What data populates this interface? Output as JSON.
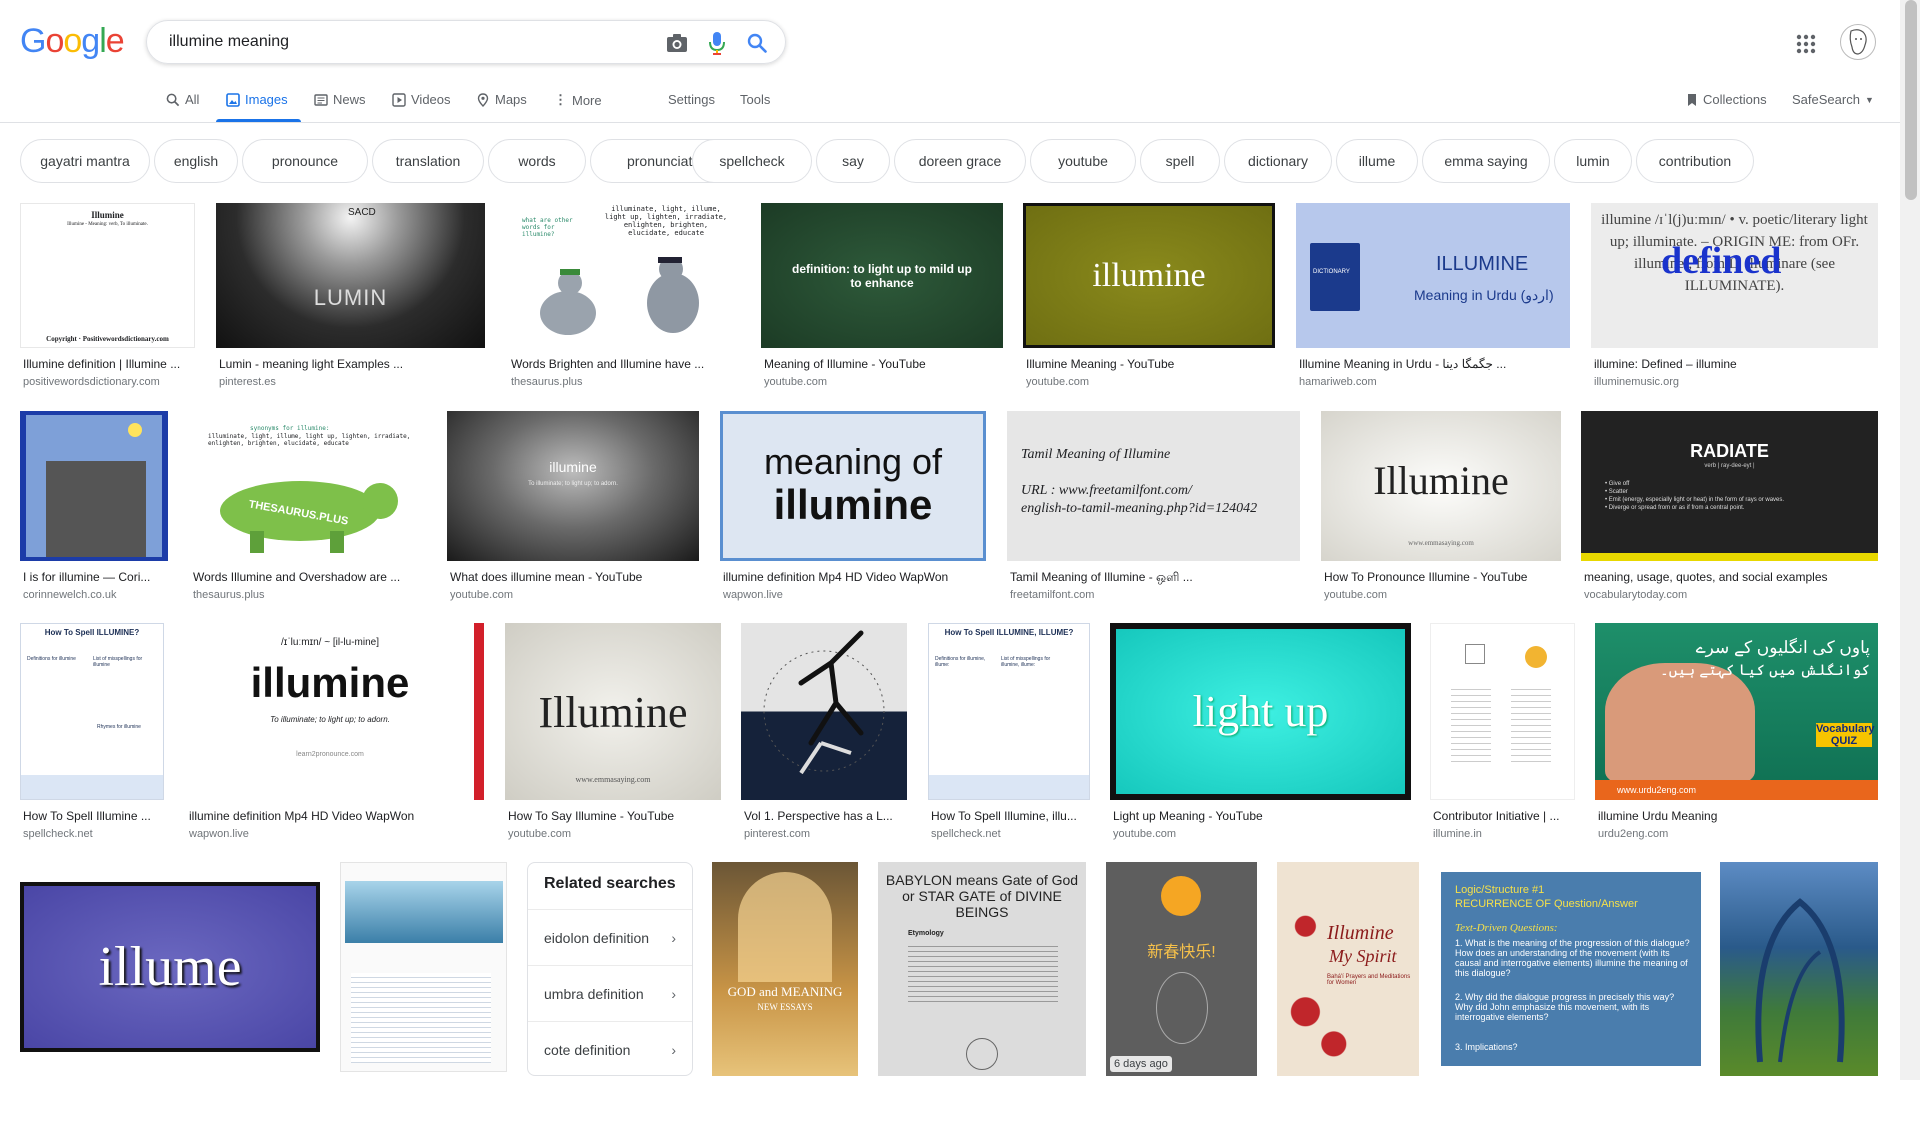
{
  "header": {
    "logo_letters": [
      "G",
      "o",
      "o",
      "g",
      "l",
      "e"
    ],
    "logo_colors": [
      "#4285f4",
      "#ea4335",
      "#fbbc05",
      "#4285f4",
      "#34a853",
      "#ea4335"
    ],
    "search_value": "illumine meaning",
    "camera_icon": "camera-icon",
    "mic_icon": "mic-icon",
    "search_icon": "search-icon",
    "apps_icon": "apps-grid-icon"
  },
  "tabs": {
    "all": "All",
    "images": "Images",
    "news": "News",
    "videos": "Videos",
    "maps": "Maps",
    "more": "More",
    "settings": "Settings",
    "tools": "Tools",
    "collections": "Collections",
    "safesearch": "SafeSearch"
  },
  "chips": [
    "gayatri mantra",
    "english",
    "pronounce",
    "translation",
    "words",
    "pronunciation",
    "spellcheck",
    "say",
    "doreen grace",
    "youtube",
    "spell",
    "dictionary",
    "illume",
    "emma saying",
    "lumin",
    "contribution"
  ],
  "results": [
    {
      "title": "Illumine definition | Illumine ...",
      "source": "positivewordsdictionary.com",
      "art": [
        "Illumine",
        "Illumine - Meaning: verb, To illuminate.",
        "Copyright · Positivewordsdictionary.com"
      ]
    },
    {
      "title": "Lumin - meaning light Examples ...",
      "source": "pinterest.es",
      "art": [
        "LUMIN",
        "SACD"
      ]
    },
    {
      "title": "Words Brighten and Illumine have ...",
      "source": "thesaurus.plus",
      "art": [
        "illuminate, light, illume, light up, lighten, irradiate, enlighten, brighten, elucidate, educate",
        "what are other words for illumine?"
      ]
    },
    {
      "title": "Meaning of Illumine - YouTube",
      "source": "youtube.com",
      "art": [
        "definition: to light up to mild up to enhance"
      ]
    },
    {
      "title": "Illumine Meaning - YouTube",
      "source": "youtube.com",
      "art": [
        "illumine"
      ]
    },
    {
      "title": "Illumine Meaning in Urdu - جگمگا دینا ...",
      "source": "hamariweb.com",
      "art": [
        "ILLUMINE",
        "Meaning in Urdu (اردو)",
        "DICTIONARY"
      ]
    },
    {
      "title": "illumine: Defined – illumine",
      "source": "illuminemusic.org",
      "art": [
        "illumine /ɪˈl(j)uːmɪn/ • v. poetic/literary light up; illuminate. – ORIGIN ME: from OFr. illuminer, from L. illuminare (see ILLUMINATE).",
        "defined"
      ]
    },
    {
      "title": "I is for illumine — Cori...",
      "source": "corinnewelch.co.uk",
      "art": []
    },
    {
      "title": "Words Illumine and Overshadow are ...",
      "source": "thesaurus.plus",
      "art": [
        "synonyms for illumine:",
        "illuminate, light, illume, light up, lighten, irradiate, enlighten, brighten, elucidate, educate",
        "THESAURUS.PLUS"
      ]
    },
    {
      "title": "What does illumine mean - YouTube",
      "source": "youtube.com",
      "art": [
        "illumine",
        "To illuminate; to light up; to adorn."
      ]
    },
    {
      "title": "illumine definition Mp4 HD Video WapWon",
      "source": "wapwon.live",
      "art": [
        "meaning of",
        "illumine"
      ]
    },
    {
      "title": "Tamil Meaning of Illumine - ஒளி ...",
      "source": "freetamilfont.com",
      "art": [
        "Tamil Meaning of Illumine",
        "URL : www.freetamilfont.com/",
        "english-to-tamil-meaning.php?id=124042"
      ]
    },
    {
      "title": "How To Pronounce Illumine - YouTube",
      "source": "youtube.com",
      "art": [
        "Illumine",
        "www.emmasaying.com"
      ]
    },
    {
      "title": "meaning, usage, quotes, and social examples",
      "source": "vocabularytoday.com",
      "art": [
        "RADIATE",
        "verb | ray-dee-eyt |",
        "• Give off",
        "• Scatter",
        "• Emit (energy, especially light or heat) in the form of rays or waves.",
        "• Diverge or spread from or as if from a central point."
      ]
    },
    {
      "title": "How To Spell Illumine ...",
      "source": "spellcheck.net",
      "art": [
        "How To Spell ILLUMINE?",
        "Definitions for illumine",
        "List of misspellings for illumine",
        "Rhymes for illumine"
      ]
    },
    {
      "title": "illumine definition Mp4 HD Video WapWon",
      "source": "wapwon.live",
      "art": [
        "/ɪˈluːmɪn/ ~ [il-lu-mine]",
        "illumine",
        "To illuminate; to light up; to adorn.",
        "learn2pronounce.com"
      ]
    },
    {
      "title": "How To Say Illumine - YouTube",
      "source": "youtube.com",
      "art": [
        "Illumine",
        "www.emmasaying.com"
      ]
    },
    {
      "title": "Vol 1. Perspective has a L...",
      "source": "pinterest.com",
      "art": []
    },
    {
      "title": "How To Spell Illumine, illu...",
      "source": "spellcheck.net",
      "art": [
        "How To Spell ILLUMINE, ILLUME?",
        "Definitions for illumine, illume:",
        "List of misspellings for illumine, illume:"
      ]
    },
    {
      "title": "Light up Meaning - YouTube",
      "source": "youtube.com",
      "art": [
        "light up"
      ]
    },
    {
      "title": "Contributor Initiative | ...",
      "source": "illumine.in",
      "art": []
    },
    {
      "title": "illumine Urdu Meaning",
      "source": "urdu2eng.com",
      "art": [
        "پاوں کی انگلیوں کے سرے",
        "کوانگلش میں کیا کہتے ہیں۔",
        "Vocabulary QUIZ",
        "www.urdu2eng.com"
      ]
    },
    {
      "title": "",
      "source": "",
      "art": [
        "illume"
      ]
    },
    {
      "title": "",
      "source": "",
      "art": []
    },
    {
      "title": "",
      "source": "",
      "art": [
        "GOD and MEANING",
        "NEW ESSAYS"
      ]
    },
    {
      "title": "",
      "source": "",
      "art": [
        "BABYLON means Gate of God or STAR GATE of DIVINE BEINGS",
        "Etymology"
      ]
    },
    {
      "title": "",
      "source": "",
      "art": [
        "新春快乐!"
      ],
      "badge": "6 days ago"
    },
    {
      "title": "",
      "source": "",
      "art": [
        "Illumine",
        "My Spirit",
        "Bahá'í Prayers and Meditations for Women"
      ]
    },
    {
      "title": "",
      "source": "",
      "art": [
        "Logic/Structure #1",
        "RECURRENCE OF Question/Answer",
        "Text-Driven Questions:",
        "1. What is the meaning of the progression of this dialogue? How does an understanding of the movement (with its causal and interrogative elements) illumine the meaning of this dialogue?",
        "2. Why did the dialogue progress in precisely this way? Why did John emphasize this movement, with its interrogative elements?",
        "3. Implications?"
      ]
    },
    {
      "title": "",
      "source": "",
      "art": []
    }
  ],
  "related": {
    "heading": "Related searches",
    "items": [
      "eidolon definition",
      "umbra definition",
      "cote definition"
    ]
  }
}
